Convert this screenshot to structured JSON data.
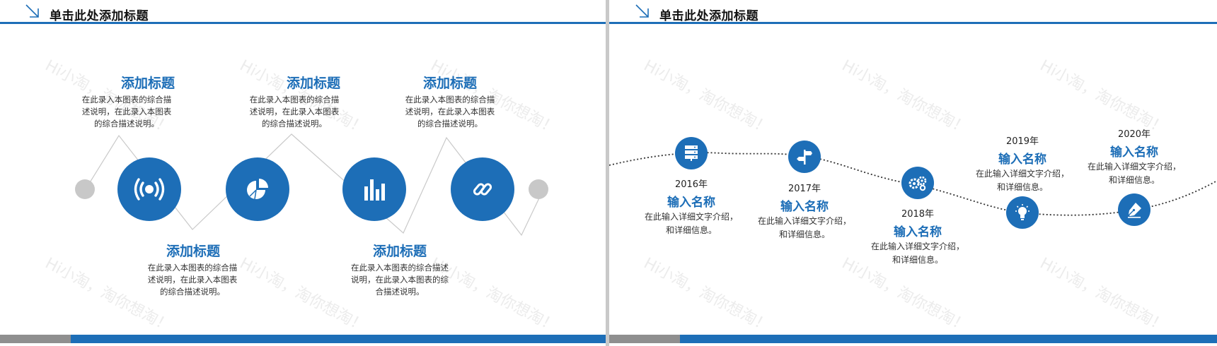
{
  "slide1": {
    "title": "单击此处添加标题",
    "items": [
      {
        "heading": "添加标题",
        "desc": "在此录入本图表的综合描述说明，在此录入本图表的综合描述说明。",
        "icon": "broadcast-icon"
      },
      {
        "heading": "添加标题",
        "desc": "在此录入本图表的综合描述说明，在此录入本图表的综合描述说明。",
        "icon": "pie-chart-icon"
      },
      {
        "heading": "添加标题",
        "desc": "在此录入本图表的综合描述说明，在此录入本图表的综合描述说明。",
        "icon": "bar-chart-icon"
      },
      {
        "heading": "添加标题",
        "desc": "在此录入本图表的综合描述说明，在此录入本图表的综合描述说明。",
        "icon": "link-icon"
      },
      {
        "heading": "添加标题",
        "desc": "在此录入本图表的综合描述说明，在此录入本图表的综合描述说明。"
      }
    ]
  },
  "slide2": {
    "title": "单击此处添加标题",
    "items": [
      {
        "year": "2016年",
        "name": "输入名称",
        "desc": "在此输入详细文字介绍，和详细信息。",
        "icon": "server-icon"
      },
      {
        "year": "2017年",
        "name": "输入名称",
        "desc": "在此输入详细文字介绍，和详细信息。",
        "icon": "signpost-icon"
      },
      {
        "year": "2018年",
        "name": "输入名称",
        "desc": "在此输入详细文字介绍，和详细信息。",
        "icon": "gears-icon"
      },
      {
        "year": "2019年",
        "name": "输入名称",
        "desc": "在此输入详细文字介绍，和详细信息。",
        "icon": "lightbulb-icon"
      },
      {
        "year": "2020年",
        "name": "输入名称",
        "desc": "在此输入详细文字介绍，和详细信息。",
        "icon": "pen-icon"
      }
    ]
  },
  "watermark": "Hi小淘，淘你想淘！",
  "colors": {
    "accent": "#1d6eb7",
    "gray": "#8f8f8f"
  }
}
